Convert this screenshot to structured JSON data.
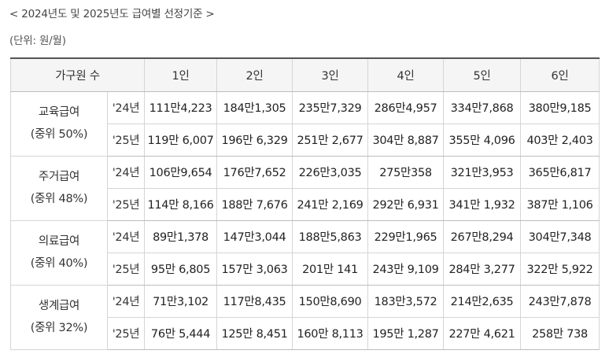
{
  "caption": "< 2024년도 및 2025년도 급여별 선정기준 >",
  "unit": "(단위: 원/월)",
  "table": {
    "header": {
      "household": "가구원 수",
      "sizes": [
        "1인",
        "2인",
        "3인",
        "4인",
        "5인",
        "6인"
      ]
    },
    "groups": [
      {
        "name": "교육급여",
        "sub": "(중위 50%)",
        "rows": [
          {
            "year": "'24년",
            "values": [
              "111만4,223",
              "184만1,305",
              "235만7,329",
              "286만4,957",
              "334만7,868",
              "380만9,185"
            ]
          },
          {
            "year": "'25년",
            "values": [
              "119만 6,007",
              "196만 6,329",
              "251만 2,677",
              "304만 8,887",
              "355만 4,096",
              "403만 2,403"
            ]
          }
        ]
      },
      {
        "name": "주거급여",
        "sub": "(중위 48%)",
        "rows": [
          {
            "year": "'24년",
            "values": [
              "106만9,654",
              "176만7,652",
              "226만3,035",
              "275만358",
              "321만3,953",
              "365만6,817"
            ]
          },
          {
            "year": "'25년",
            "values": [
              "114만 8,166",
              "188만 7,676",
              "241만 2,169",
              "292만 6,931",
              "341만 1,932",
              "387만 1,106"
            ]
          }
        ]
      },
      {
        "name": "의료급여",
        "sub": "(중위 40%)",
        "rows": [
          {
            "year": "'24년",
            "values": [
              "89만1,378",
              "147만3,044",
              "188만5,863",
              "229만1,965",
              "267만8,294",
              "304만7,348"
            ]
          },
          {
            "year": "'25년",
            "values": [
              "95만 6,805",
              "157만 3,063",
              "201만 141",
              "243만 9,109",
              "284만 3,277",
              "322만 5,922"
            ]
          }
        ]
      },
      {
        "name": "생계급여",
        "sub": "(중위 32%)",
        "rows": [
          {
            "year": "'24년",
            "values": [
              "71만3,102",
              "117만8,435",
              "150만8,690",
              "183만3,572",
              "214만2,635",
              "243만7,878"
            ]
          },
          {
            "year": "'25년",
            "values": [
              "76만 5,444",
              "125만 8,451",
              "160만 8,113",
              "195만 1,287",
              "227만 4,621",
              "258만 738"
            ]
          }
        ]
      }
    ]
  }
}
